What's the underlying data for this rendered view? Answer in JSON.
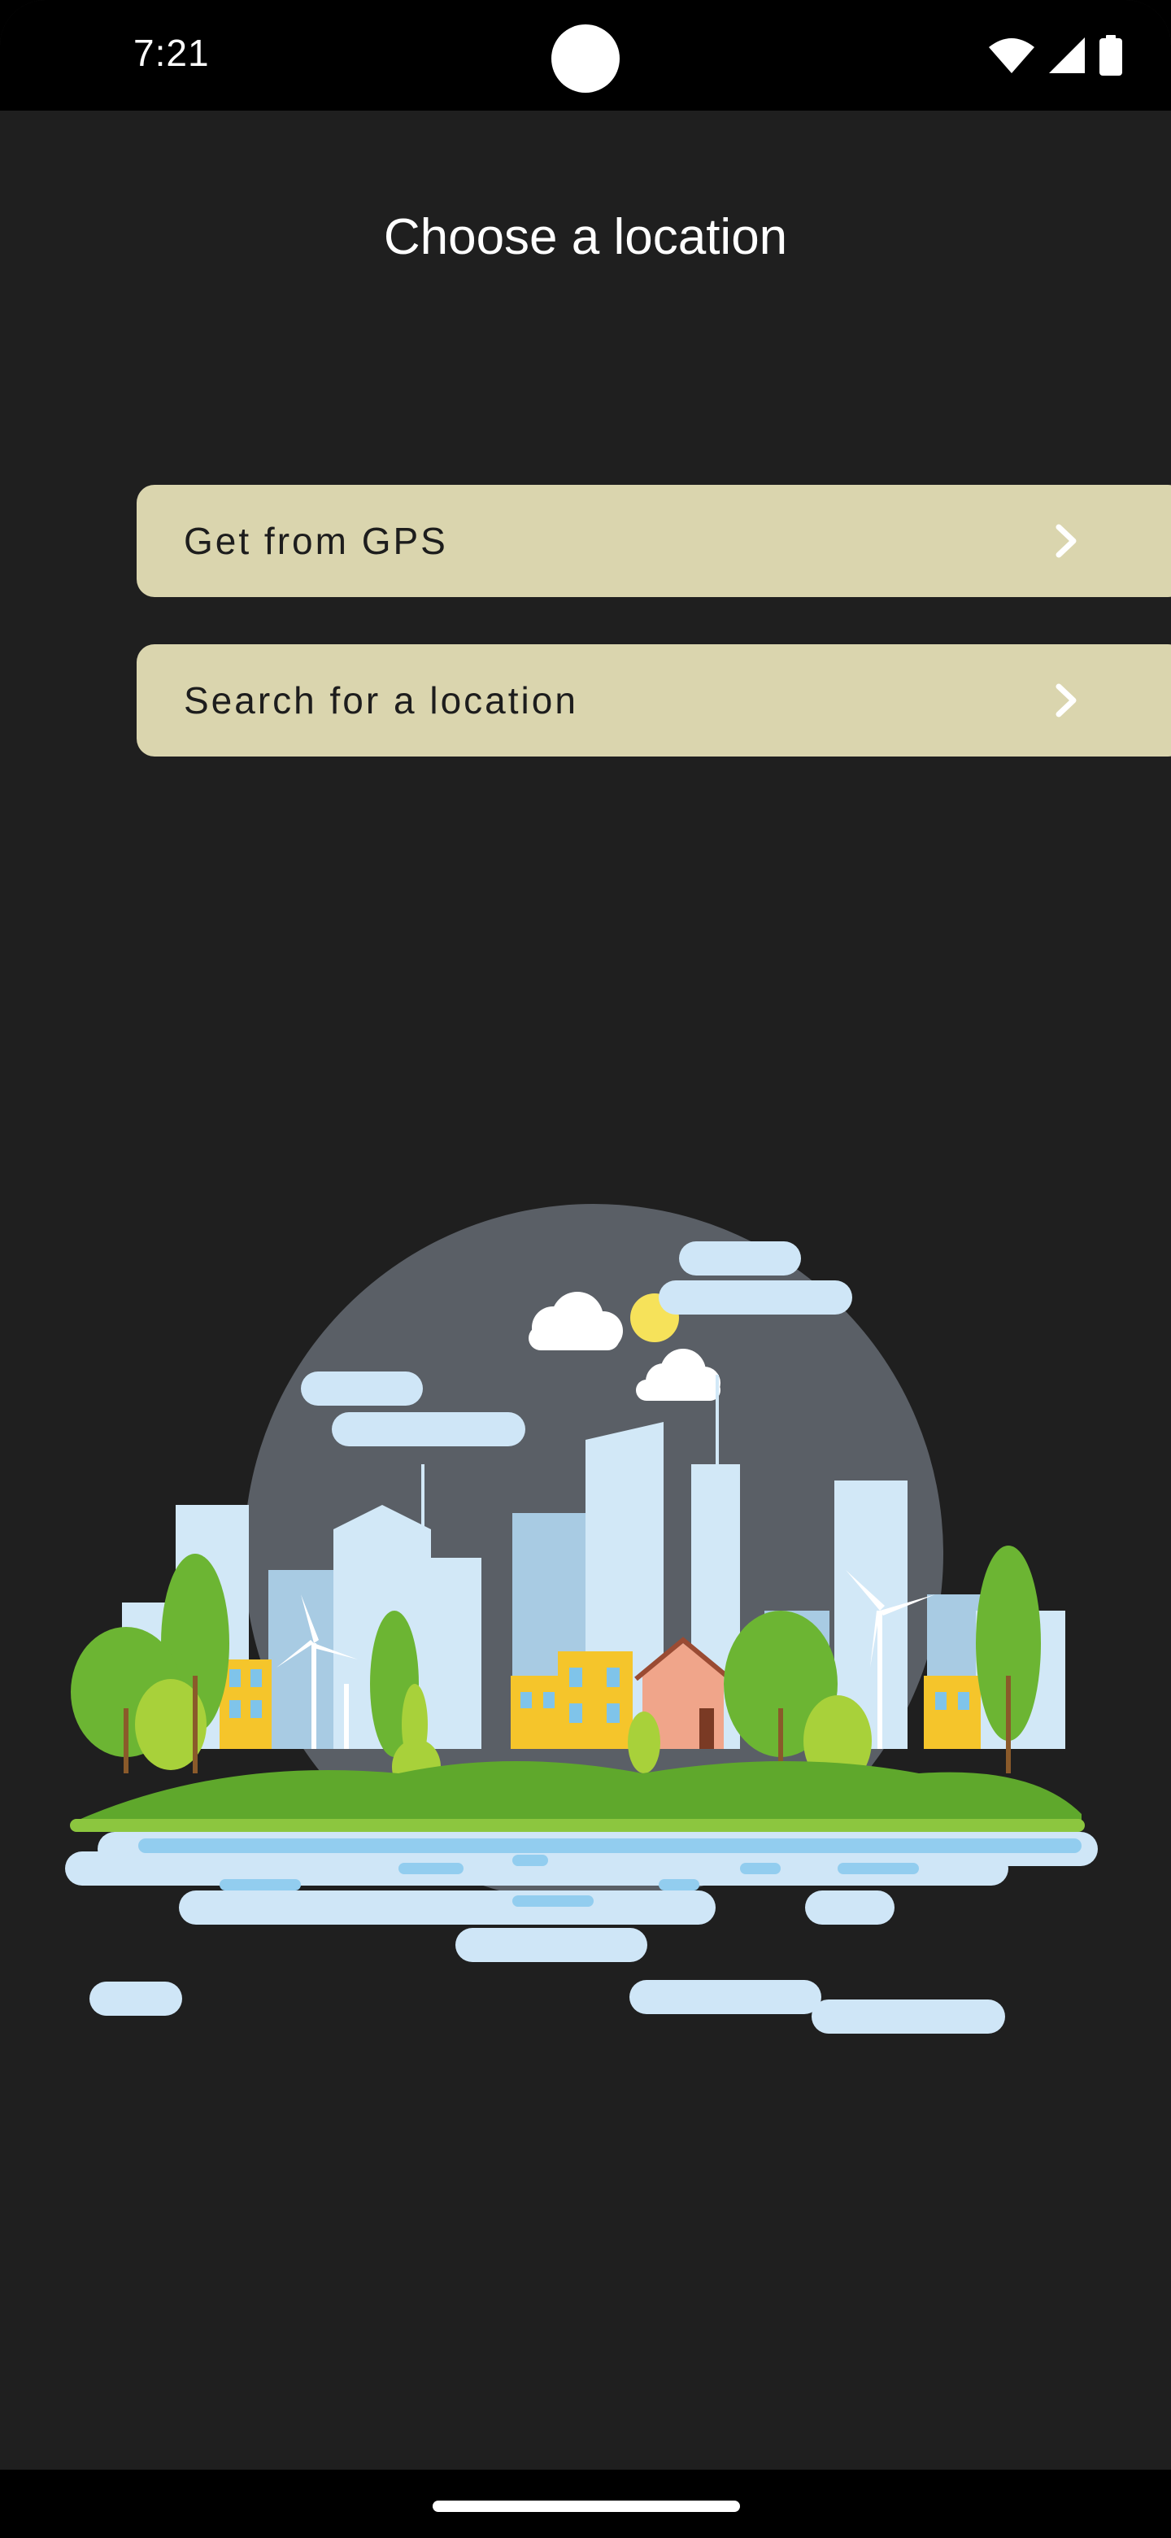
{
  "status_bar": {
    "time": "7:21",
    "icons": [
      "wifi-icon",
      "cell-signal-icon",
      "battery-icon"
    ]
  },
  "title": "Choose a location",
  "options": [
    {
      "label": "Get from GPS",
      "icon": "chevron-right-icon"
    },
    {
      "label": "Search for a location",
      "icon": "chevron-right-icon"
    }
  ],
  "illustration": {
    "subject": "city-skyline-illustration"
  },
  "colors": {
    "background": "#1f1f1f",
    "button_fill": "#dad5ae",
    "button_text": "#1d1d1d",
    "title_text": "#ffffff"
  }
}
